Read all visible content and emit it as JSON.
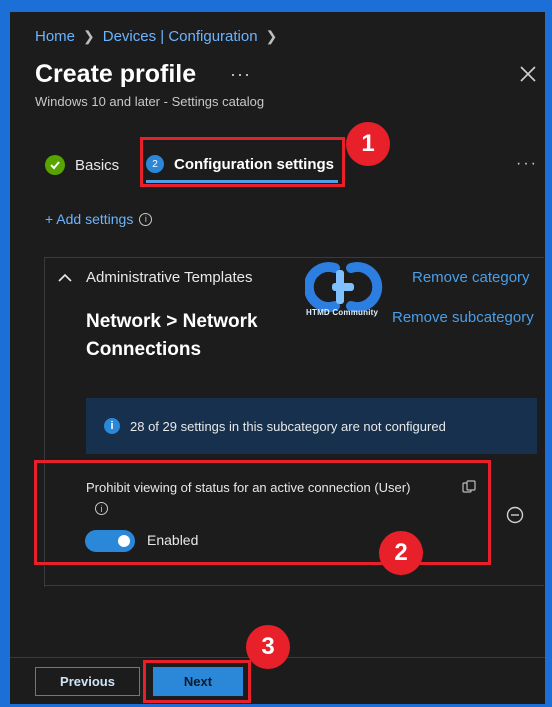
{
  "breadcrumb": {
    "home": "Home",
    "devices": "Devices | Configuration"
  },
  "header": {
    "title": "Create profile",
    "more": "···",
    "subtitle": "Windows 10 and later - Settings catalog"
  },
  "tabs": [
    {
      "label": "Basics",
      "state": "complete"
    },
    {
      "step": "2",
      "label": "Configuration settings",
      "state": "active"
    }
  ],
  "tabs_more": "···",
  "add_settings": {
    "label": "+ Add settings"
  },
  "category": {
    "name": "Administrative Templates",
    "remove": "Remove category"
  },
  "subcategory": {
    "name": "Network > Network Connections",
    "remove": "Remove subcategory"
  },
  "logo": {
    "text": "HTMD Community"
  },
  "info_banner": {
    "text": "28 of 29 settings in this subcategory are not configured"
  },
  "setting": {
    "label": "Prohibit viewing of status for an active connection (User)",
    "toggle_label": "Enabled",
    "toggle_on": true
  },
  "footer": {
    "previous": "Previous",
    "next": "Next"
  },
  "annotations": {
    "badge1": "1",
    "badge2": "2",
    "badge3": "3"
  },
  "colors": {
    "accent": "#2b88d8",
    "link": "#6cb4ff",
    "annotation_red": "#e8202a",
    "page_background": "#1b6fd6",
    "panel_background": "#1c1c1c",
    "success": "#57a300"
  },
  "icons": [
    "chevron-right-icon",
    "close-icon",
    "checkmark-icon",
    "info-icon",
    "chevron-up-icon",
    "copy-icon",
    "remove-circle-icon"
  ]
}
